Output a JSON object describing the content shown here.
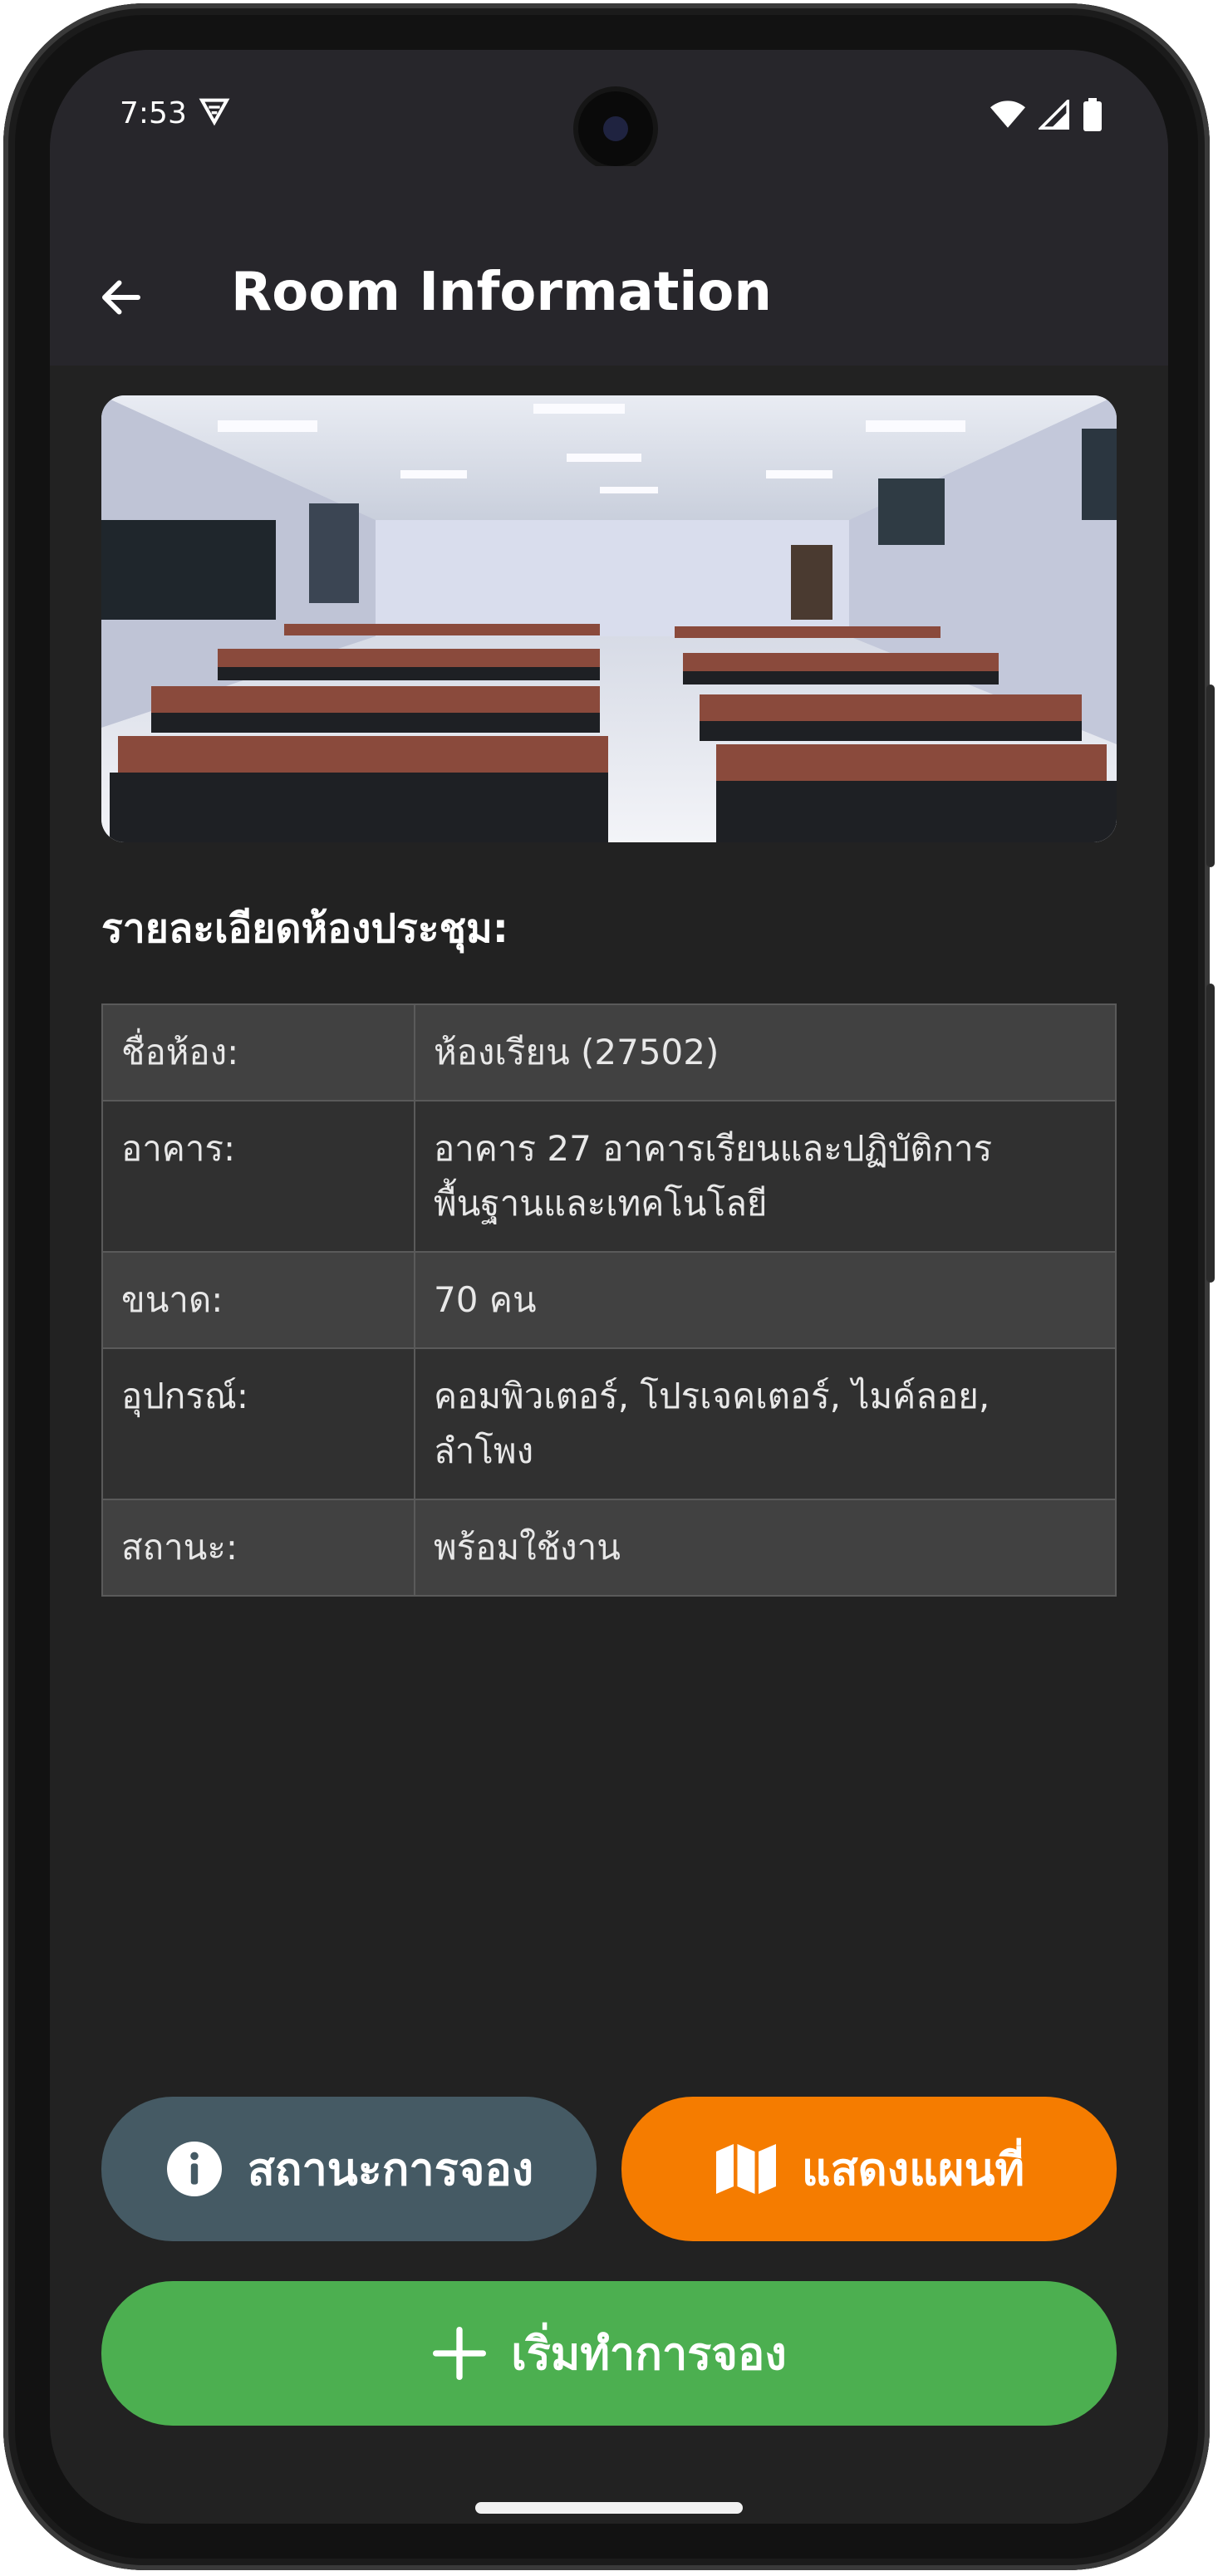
{
  "status_bar": {
    "time": "7:53"
  },
  "app_bar": {
    "title": "Room Information"
  },
  "section_title": "รายละเอียดห้องประชุม:",
  "details": [
    {
      "label": "ชื่อห้อง:",
      "value": "ห้องเรียน (27502)"
    },
    {
      "label": "อาคาร:",
      "value": "อาคาร 27 อาคารเรียนและปฏิบัติการ\nพื้นฐานและเทคโนโลยี"
    },
    {
      "label": "ขนาด:",
      "value": "70 คน"
    },
    {
      "label": "อุปกรณ์:",
      "value": "คอมพิวเตอร์, โปรเจคเตอร์, ไมค์ลอย,\nลำโพง"
    },
    {
      "label": "สถานะ:",
      "value": "พร้อมใช้งาน"
    }
  ],
  "buttons": {
    "booking_status": "สถานะการจอง",
    "show_map": "แสดงแผนที่",
    "start_booking": "เริ่มทำการจอง"
  },
  "colors": {
    "status_button": "#455a64",
    "map_button": "#f57c00",
    "booking_button": "#4caf50",
    "background": "#222222",
    "app_bar": "#27262b"
  },
  "icons": {
    "back": "arrow-left-icon",
    "booking_status": "info-circle-icon",
    "show_map": "map-icon",
    "start_booking": "plus-icon"
  }
}
